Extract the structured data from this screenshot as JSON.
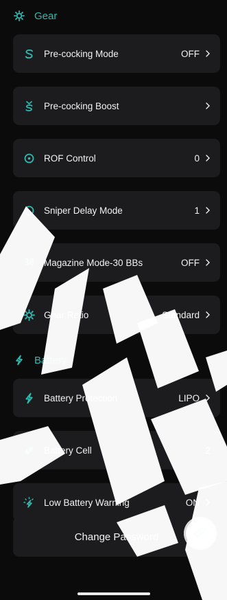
{
  "sections": {
    "gear": {
      "title": "Gear"
    },
    "battery": {
      "title": "Battery"
    }
  },
  "settings": {
    "precocking_mode": {
      "label": "Pre-cocking Mode",
      "value": "OFF"
    },
    "precocking_boost": {
      "label": "Pre-cocking Boost",
      "value": ""
    },
    "rof_control": {
      "label": "ROF Control",
      "value": "0"
    },
    "sniper_delay": {
      "label": "Sniper Delay Mode",
      "value": "1"
    },
    "magazine_mode": {
      "label": "Magazine Mode-30 BBs",
      "value": "OFF",
      "icon_text": "30"
    },
    "gear_ratio": {
      "label": "Gear Ratio",
      "value": "Standard"
    },
    "battery_protection": {
      "label": "Battery Protection",
      "value": "LIPO"
    },
    "battery_cell": {
      "label": "Battery Cell",
      "value": "2"
    },
    "low_battery_warning": {
      "label": "Low Battery Warning",
      "value": "ON"
    }
  },
  "change_password": {
    "label": "Change Password"
  },
  "icons": {
    "gear": "gear-icon",
    "precocking_mode": "s-curve-icon",
    "precocking_boost": "boost-icon",
    "rof": "target-icon",
    "sniper": "no-symbol-icon",
    "battery": "lightning-icon",
    "battery_cell": "battery-cell-icon",
    "low_battery": "warning-bolt-icon",
    "fab": "bullet-icon"
  },
  "colors": {
    "accent": "#2fb8b0",
    "row_bg": "#1c1c1e",
    "background": "#0b0b0b"
  }
}
